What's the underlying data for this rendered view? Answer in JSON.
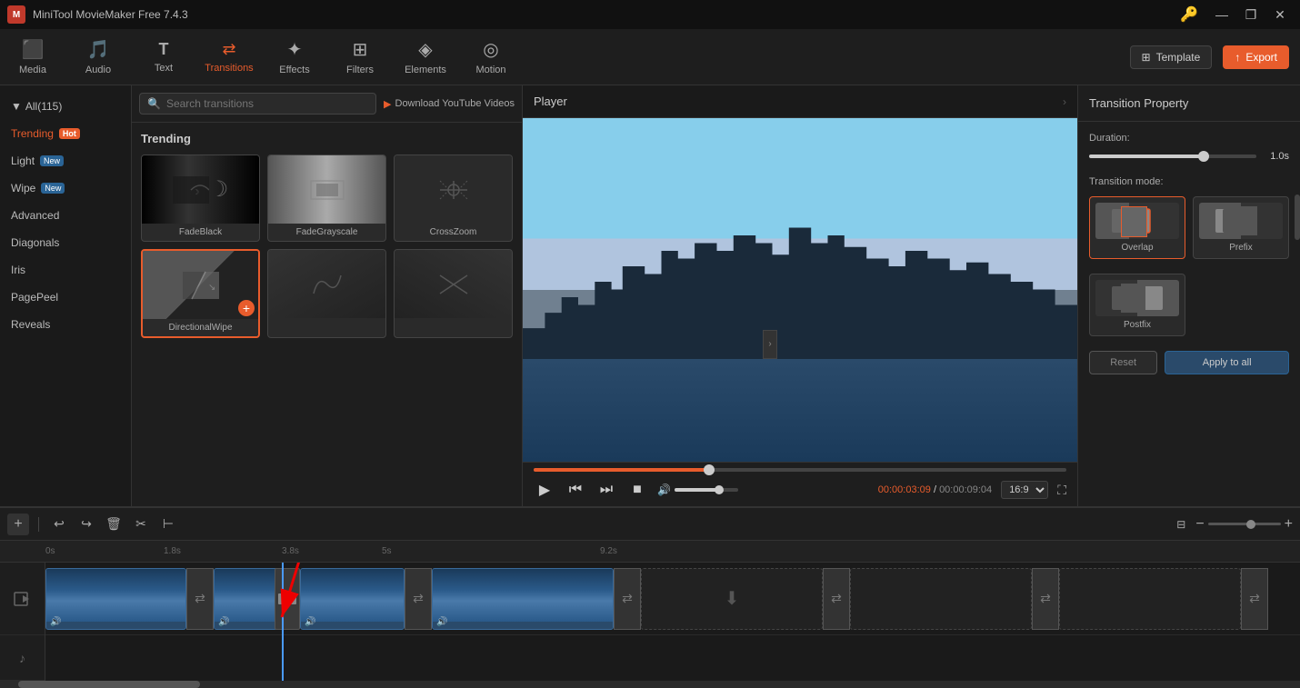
{
  "app": {
    "title": "MiniTool MovieMaker Free 7.4.3",
    "logo": "M"
  },
  "win_controls": {
    "key": "🔑",
    "minimize": "—",
    "maximize": "□",
    "restore": "❐",
    "close": "✕"
  },
  "toolbar": {
    "items": [
      {
        "id": "media",
        "icon": "☰",
        "label": "Media",
        "active": false
      },
      {
        "id": "audio",
        "icon": "♪",
        "label": "Audio",
        "active": false
      },
      {
        "id": "text",
        "icon": "T",
        "label": "Text",
        "active": false
      },
      {
        "id": "transitions",
        "icon": "⇄",
        "label": "Transitions",
        "active": true
      },
      {
        "id": "effects",
        "icon": "✦",
        "label": "Effects",
        "active": false
      },
      {
        "id": "filters",
        "icon": "⊞",
        "label": "Filters",
        "active": false
      },
      {
        "id": "elements",
        "icon": "◈",
        "label": "Elements",
        "active": false
      },
      {
        "id": "motion",
        "icon": "◎",
        "label": "Motion",
        "active": false
      }
    ],
    "template_btn": "Template",
    "export_btn": "Export"
  },
  "category": {
    "all_label": "All(115)",
    "items": [
      {
        "id": "trending",
        "label": "Trending",
        "badge": "Hot",
        "active": true
      },
      {
        "id": "light",
        "label": "Light",
        "badge_new": "New",
        "active": false
      },
      {
        "id": "wipe",
        "label": "Wipe",
        "badge_new": "New",
        "active": false
      },
      {
        "id": "advanced",
        "label": "Advanced",
        "active": false
      },
      {
        "id": "diagonals",
        "label": "Diagonals",
        "active": false
      },
      {
        "id": "iris",
        "label": "Iris",
        "active": false
      },
      {
        "id": "pagepeel",
        "label": "PagePeel",
        "active": false
      },
      {
        "id": "reveals",
        "label": "Reveals",
        "active": false
      }
    ]
  },
  "transitions_panel": {
    "search_placeholder": "Search transitions",
    "download_label": "Download YouTube Videos",
    "section_label": "Trending",
    "items": [
      {
        "id": "fadeblack",
        "name": "FadeBlack",
        "selected": false,
        "thumb": "fadeblack"
      },
      {
        "id": "fadegrayscale",
        "name": "FadeGrayscale",
        "selected": false,
        "thumb": "fadegrayscale"
      },
      {
        "id": "crosszoom",
        "name": "CrossZoom",
        "selected": false,
        "thumb": "crosszoom"
      },
      {
        "id": "directionalwipe",
        "name": "DirectionalWipe",
        "selected": true,
        "thumb": "directionalwipe"
      },
      {
        "id": "generic5",
        "name": "",
        "selected": false,
        "thumb": "generic1"
      },
      {
        "id": "generic6",
        "name": "",
        "selected": false,
        "thumb": "generic2"
      }
    ]
  },
  "player": {
    "title": "Player",
    "time_current": "00:00:03:09",
    "time_separator": " / ",
    "time_total": "00:00:09:04",
    "ratio": "16:9",
    "progress_percent": 33
  },
  "right_panel": {
    "title": "Transition Property",
    "duration_label": "Duration:",
    "duration_value": "1.0s",
    "transition_mode_label": "Transition mode:",
    "modes": [
      {
        "id": "overlap",
        "label": "Overlap",
        "selected": true
      },
      {
        "id": "prefix",
        "label": "Prefix",
        "selected": false
      },
      {
        "id": "postfix",
        "label": "Postfix",
        "selected": false
      }
    ],
    "reset_label": "Reset",
    "apply_all_label": "Apply to all"
  },
  "timeline": {
    "tools": {
      "undo": "↩",
      "redo": "↪",
      "delete": "🗑",
      "cut": "✂",
      "split": "⊢"
    },
    "ruler_marks": [
      "0s",
      "1.8s",
      "3.8s",
      "5s",
      "9.2s"
    ],
    "add_track": "+",
    "zoom_minus": "−",
    "zoom_plus": "+"
  }
}
